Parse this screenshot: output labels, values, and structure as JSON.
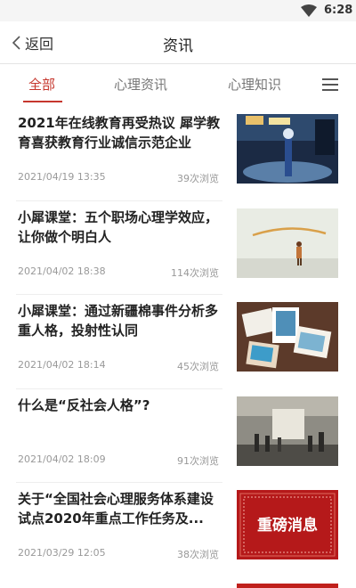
{
  "status_bar": {
    "time": "6:28"
  },
  "header": {
    "back_label": "返回",
    "title": "资讯"
  },
  "tabs": [
    {
      "label": "全部",
      "active": true
    },
    {
      "label": "心理资讯",
      "active": false
    },
    {
      "label": "心理知识",
      "active": false
    }
  ],
  "articles": [
    {
      "title": "2021年在线教育再受热议 犀学教育喜获教育行业诚信示范企业",
      "date": "2021/04/19 13:35",
      "views": "39次浏览",
      "thumb": "award-stage-photo"
    },
    {
      "title": "小犀课堂：五个职场心理学效应，让你做个明白人",
      "date": "2021/04/02 18:38",
      "views": "114次浏览",
      "thumb": "girl-wall-photo"
    },
    {
      "title": "小犀课堂：通过新疆棉事件分析多重人格，投射性认同",
      "date": "2021/04/02 18:14",
      "views": "45次浏览",
      "thumb": "photos-collage"
    },
    {
      "title": "什么是“反社会人格”?",
      "date": "2021/04/02 18:09",
      "views": "91次浏览",
      "thumb": "factory-crowd-photo"
    },
    {
      "title": "关于“全国社会心理服务体系建设试点2020年重点工作任务及...",
      "date": "2021/03/29 12:05",
      "views": "38次浏览",
      "thumb": "important-news-banner",
      "thumb_text": "重磅消息"
    }
  ],
  "colors": {
    "accent": "#c6372e",
    "banner_red": "#c0201c"
  }
}
